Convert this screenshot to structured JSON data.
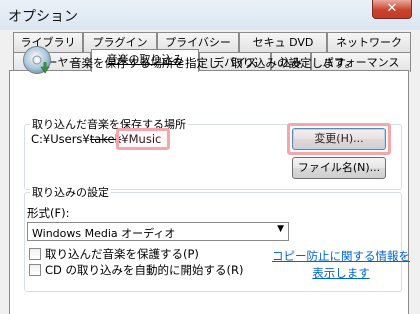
{
  "window": {
    "title": "オプション",
    "close_glyph": "✕"
  },
  "tabs": {
    "row1": [
      {
        "label": "ライブラリ"
      },
      {
        "label": "プラグイン"
      },
      {
        "label": "プライバシー"
      },
      {
        "label": "セキュ DVD"
      },
      {
        "label": "ネットワーク"
      }
    ],
    "row2": [
      {
        "label": "プレーヤー"
      },
      {
        "label": "音楽の取り込み",
        "active": true
      },
      {
        "label": "デバイス"
      },
      {
        "label": "込み"
      },
      {
        "label": "パフォーマンス"
      }
    ]
  },
  "rip": {
    "description": "音楽を保存する場所を指定し、取り込みの設定します。",
    "location_legend": "取り込んだ音楽を保存する場所",
    "path_prefix": "C:¥Users¥",
    "path_user": "takek",
    "path_suffix": "¥Music",
    "change_button": "変更(H)...",
    "filename_button": "ファイル名(N)...",
    "settings_legend": "取り込みの設定",
    "format_label": "形式(F):",
    "format_value": "Windows Media オーディオ",
    "protect_label": "取り込んだ音楽を保護する(P)",
    "auto_rip_label": "CD の取り込みを自動的に開始する(R)",
    "copy_protection_link_line1": "コピー防止に関する情報を",
    "copy_protection_link_line2": "表示します"
  },
  "icons": {
    "cd": "cd-disc-icon",
    "close": "close-icon",
    "dropdown": "chevron-down-icon"
  },
  "colors": {
    "title_bar": "#dbe6f1",
    "close_red": "#c8452d",
    "highlight_pink": "#f2a7ad",
    "link_blue": "#0066cc"
  }
}
